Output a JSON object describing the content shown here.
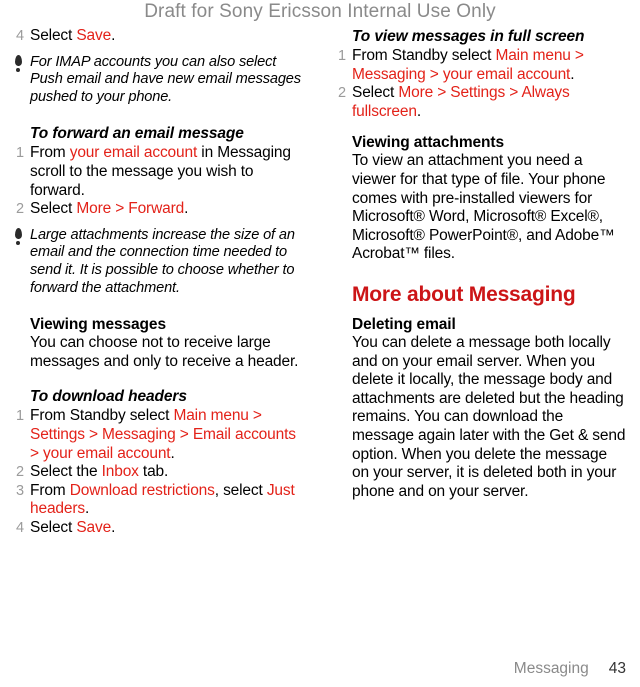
{
  "watermark": "Draft for Sony Ericsson Internal Use Only",
  "left_column": {
    "trailing_step": {
      "number": "4",
      "prefix": "Select ",
      "link": "Save",
      "suffix": "."
    },
    "note_imap": {
      "icon": "tip-icon",
      "text": "For IMAP accounts you can also select Push email and have new email messages pushed to your phone."
    },
    "forward_section": {
      "heading": "To forward an email message",
      "steps": [
        {
          "number": "1",
          "prefix": "From ",
          "link": "your email account",
          "suffix": " in Messaging scroll to the message you wish to forward."
        },
        {
          "number": "2",
          "prefix": "Select ",
          "link": "More > Forward",
          "suffix": "."
        }
      ]
    },
    "note_attachments": {
      "icon": "tip-icon",
      "text": "Large attachments increase the size of an email and the connection time needed to send it. It is possible to choose whether to forward the attachment."
    },
    "viewing_messages": {
      "heading": "Viewing messages",
      "body": "You can choose not to receive large messages and only to receive a header."
    },
    "download_headers": {
      "heading": "To download headers",
      "steps": [
        {
          "number": "1",
          "prefix": "From Standby select ",
          "link": "Main menu > Settings > Messaging > Email accounts > your email account",
          "suffix": "."
        },
        {
          "number": "2",
          "prefix": "Select the ",
          "link": "Inbox",
          "suffix": " tab."
        },
        {
          "number": "3",
          "prefix": "From ",
          "link": "Download restrictions",
          "suffix": ", select ",
          "link2": "Just headers",
          "suffix2": "."
        },
        {
          "number": "4",
          "prefix": "Select ",
          "link": "Save",
          "suffix": "."
        }
      ]
    }
  },
  "right_column": {
    "fullscreen_section": {
      "heading": "To view messages in full screen",
      "steps": [
        {
          "number": "1",
          "prefix": "From Standby select ",
          "link": "Main menu > Messaging > your email account",
          "suffix": "."
        },
        {
          "number": "2",
          "prefix": "Select ",
          "link": "More > Settings > Always fullscreen",
          "suffix": "."
        }
      ]
    },
    "viewing_attachments": {
      "heading": "Viewing attachments",
      "body": "To view an attachment you need a viewer for that type of file. Your phone comes with pre-installed viewers for Microsoft® Word, Microsoft® Excel®, Microsoft® PowerPoint®, and Adobe™ Acrobat™ files."
    },
    "more_about": {
      "heading": "More about Messaging",
      "deleting_email": {
        "heading": "Deleting email",
        "body": "You can delete a message both locally and on your email server. When you delete it locally, the message body and attachments are deleted but the heading remains. You can download the message again later with the Get & send option. When you delete the message on your server, it is deleted both in your phone and on your server."
      }
    }
  },
  "footer": {
    "chapter": "Messaging",
    "page_number": "43"
  },
  "colors": {
    "link_red": "#e32219",
    "heading_red": "#cc1517",
    "watermark_gray": "#8a8a8a",
    "step_number_gray": "#9b9b9b"
  }
}
